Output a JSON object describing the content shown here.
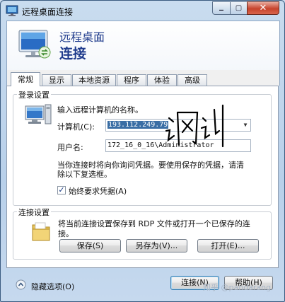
{
  "window": {
    "title": "远程桌面连接"
  },
  "header": {
    "line1": "远程桌面",
    "line2": "连接"
  },
  "tabs": [
    {
      "label": "常规",
      "active": true
    },
    {
      "label": "显示"
    },
    {
      "label": "本地资源"
    },
    {
      "label": "程序"
    },
    {
      "label": "体验"
    },
    {
      "label": "高级"
    }
  ],
  "login": {
    "group_label": "登录设置",
    "prompt": "输入远程计算机的名称。",
    "computer_label": "计算机(C):",
    "computer_value": "193.112.249.79",
    "username_label": "用户名:",
    "username_value": "172_16_0_16\\Administrator",
    "info_line1": "当你连接时将向你询问凭据。要使用保存的凭据，请清",
    "info_line2": "除以下复选框。",
    "always_ask_label": "始终要求凭据(A)",
    "always_ask_checked": true
  },
  "connection": {
    "group_label": "连接设置",
    "desc_line1": "将当前连接设置保存到 RDP 文件或打开一个已保存的连",
    "desc_line2": "接。",
    "save_button": "保存(S)",
    "save_as_button": "另存为(V)...",
    "open_button": "打开(E)..."
  },
  "footer": {
    "hide_options_label": "隐藏选项(O)",
    "connect_button": "连接(N)",
    "help_button": "帮助(H)"
  },
  "watermark": "知乎 @pandarang",
  "colors": {
    "accent": "#1f3b8c",
    "selection": "#3a6ea5",
    "close_button": "#c6432c"
  }
}
